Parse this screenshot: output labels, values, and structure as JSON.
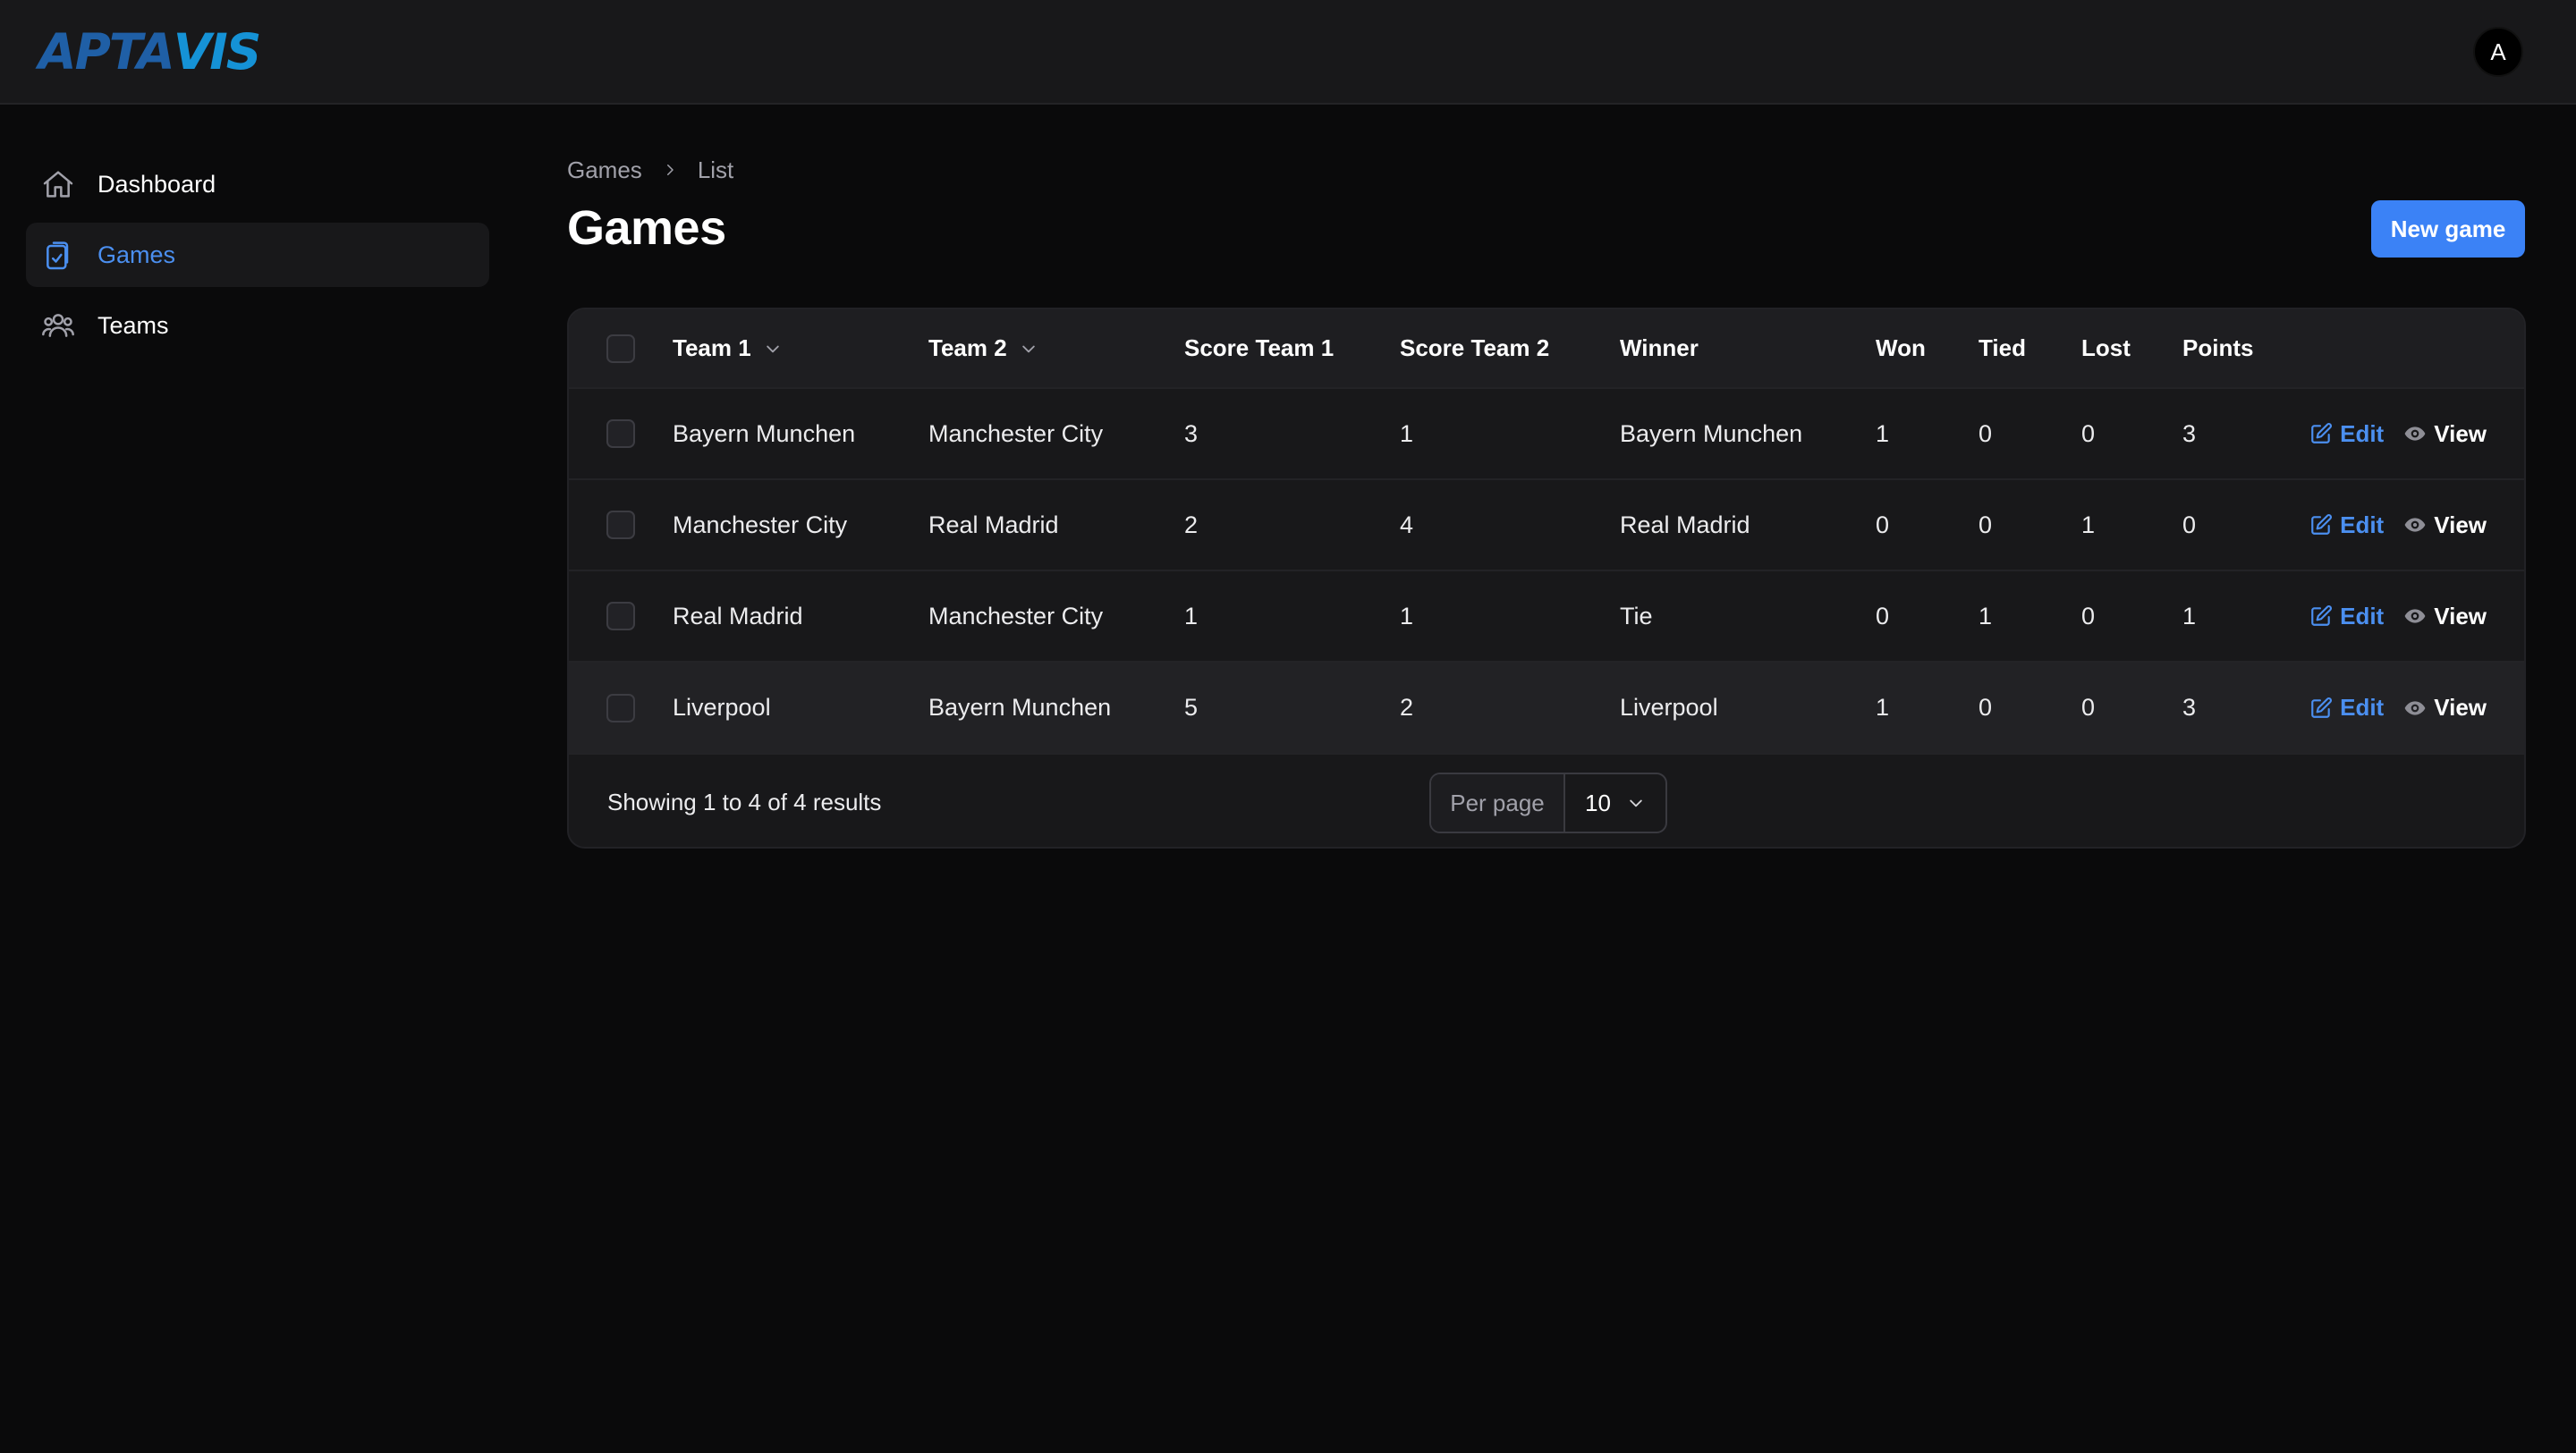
{
  "app": {
    "logo_part1": "APTA",
    "logo_part2": "VIS",
    "avatar_letter": "A"
  },
  "sidebar": {
    "items": [
      {
        "label": "Dashboard",
        "icon": "home-icon",
        "active": false
      },
      {
        "label": "Games",
        "icon": "clipboard-check-icon",
        "active": true
      },
      {
        "label": "Teams",
        "icon": "users-icon",
        "active": false
      }
    ]
  },
  "breadcrumb": {
    "root": "Games",
    "current": "List"
  },
  "page": {
    "title": "Games",
    "new_button": "New game"
  },
  "table": {
    "columns": [
      "Team 1",
      "Team 2",
      "Score Team 1",
      "Score Team 2",
      "Winner",
      "Won",
      "Tied",
      "Lost",
      "Points"
    ],
    "rows": [
      [
        "Bayern Munchen",
        "Manchester City",
        "3",
        "1",
        "Bayern Munchen",
        "1",
        "0",
        "0",
        "3"
      ],
      [
        "Manchester City",
        "Real Madrid",
        "2",
        "4",
        "Real Madrid",
        "0",
        "0",
        "1",
        "0"
      ],
      [
        "Real Madrid",
        "Manchester City",
        "1",
        "1",
        "Tie",
        "0",
        "1",
        "0",
        "1"
      ],
      [
        "Liverpool",
        "Bayern Munchen",
        "5",
        "2",
        "Liverpool",
        "1",
        "0",
        "0",
        "3"
      ]
    ],
    "edit_label": "Edit",
    "view_label": "View"
  },
  "footer": {
    "results": "Showing 1 to 4 of 4 results",
    "per_page_label": "Per page",
    "per_page_value": "10"
  },
  "colors": {
    "accent": "#3b82f6",
    "link": "#4b8ff0",
    "background": "#0a0a0b",
    "surface": "#18181a"
  }
}
